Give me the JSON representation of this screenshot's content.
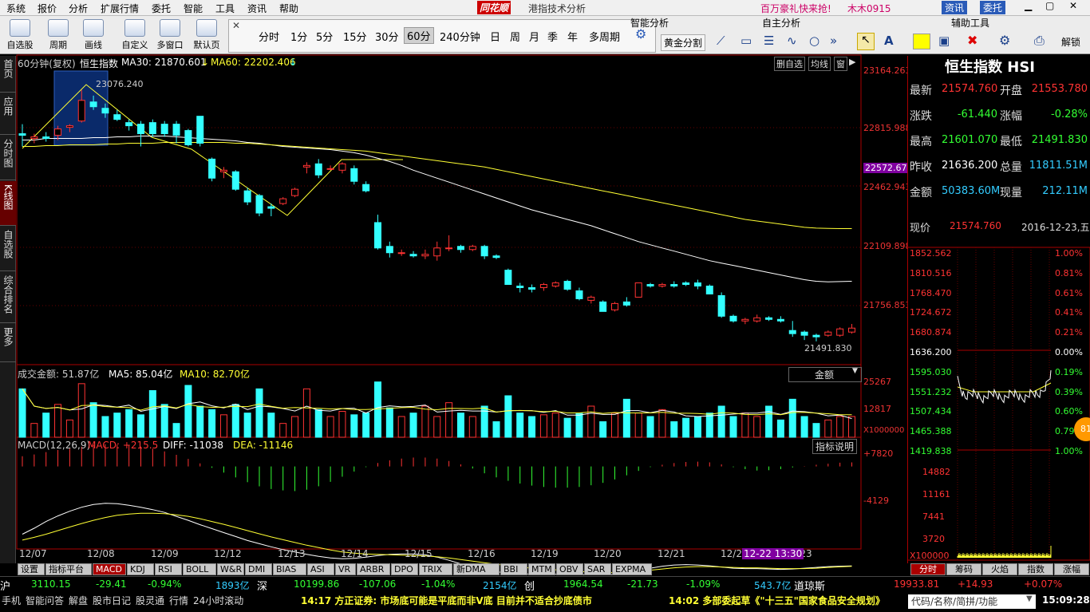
{
  "menubar": {
    "items": [
      "系统",
      "报价",
      "分析",
      "扩展行情",
      "委托",
      "智能",
      "工具",
      "资讯",
      "帮助"
    ],
    "brand": "同花顺",
    "window_title": "港指技术分析",
    "promo": "百万豪礼快来抢!",
    "user": "木木0915",
    "right_btns": [
      "资讯",
      "委托"
    ]
  },
  "toolbar": {
    "buttons": [
      "自选股",
      "周期",
      "画线",
      "自定义",
      "多窗口",
      "默认页"
    ],
    "periods": [
      "分时",
      "1分",
      "5分",
      "15分",
      "30分",
      "60分",
      "240分钟",
      "日",
      "周",
      "月",
      "季",
      "年",
      "多周期"
    ],
    "selected_period": "60分",
    "smart_title": "智能分析",
    "golden": "黄金分割",
    "self_title": "自主分析",
    "aux_title": "辅助工具",
    "aux_a": "A",
    "unlock": "解锁"
  },
  "leftnav": [
    "首页",
    "应用",
    "分时图",
    "K线图",
    "自选股",
    "综合排名",
    "更多"
  ],
  "chart_header": {
    "period": "60分钟(复权)",
    "name": "恒生指数",
    "ma30_label": "MA30: 21870.601",
    "ma60_label": "MA60: 22202.406",
    "arrows": [
      "↓",
      "↓"
    ],
    "right_tabs": [
      "删自选",
      "均线",
      "窗"
    ]
  },
  "kline": {
    "ylim": [
      21380,
      23200
    ],
    "y_labels": [
      "23164.263",
      "22815.988",
      "22572.67",
      "22462.943",
      "22109.898",
      "21756.853"
    ],
    "highlight_label": "22572.67",
    "high_label": "23076.240",
    "low_label": "21491.830",
    "dates": [
      "12/07",
      "12/08",
      "12/09",
      "12/12",
      "12/13",
      "12/14",
      "12/15",
      "12/16",
      "12/19",
      "12/20",
      "12/21",
      "12/22",
      "12/23"
    ],
    "cursor_label": "12-22 13:30"
  },
  "chart_data": [
    {
      "type": "candlestick",
      "title": "恒生指数",
      "candles": [
        [
          22800,
          22860,
          22720,
          22790
        ],
        [
          22770,
          22800,
          22740,
          22780
        ],
        [
          22780,
          22810,
          22750,
          22770
        ],
        [
          22790,
          22850,
          22760,
          22830
        ],
        [
          22840,
          22860,
          22810,
          22850
        ],
        [
          22880,
          23076,
          22870,
          23010
        ],
        [
          23000,
          23040,
          22950,
          22970
        ],
        [
          22960,
          22990,
          22900,
          22930
        ],
        [
          22920,
          22950,
          22880,
          22890
        ],
        [
          22870,
          22890,
          22820,
          22850
        ],
        [
          22860,
          22880,
          22720,
          22800
        ],
        [
          22870,
          22890,
          22780,
          22800
        ],
        [
          22860,
          22880,
          22780,
          22800
        ],
        [
          22860,
          22880,
          22740,
          22790
        ],
        [
          22820,
          22830,
          22720,
          22730
        ],
        [
          22910,
          22910,
          22720,
          22740
        ],
        [
          22640,
          22650,
          22500,
          22520
        ],
        [
          22560,
          22590,
          22520,
          22570
        ],
        [
          22560,
          22570,
          22440,
          22450
        ],
        [
          22440,
          22460,
          22350,
          22370
        ],
        [
          22410,
          22420,
          22280,
          22300
        ],
        [
          22340,
          22360,
          22280,
          22330
        ],
        [
          22360,
          22400,
          22350,
          22390
        ],
        [
          22410,
          22460,
          22400,
          22450
        ],
        [
          22590,
          22620,
          22550,
          22600
        ],
        [
          22610,
          22640,
          22520,
          22540
        ],
        [
          22580,
          22600,
          22570,
          22580
        ],
        [
          22570,
          22620,
          22550,
          22610
        ],
        [
          22580,
          22600,
          22480,
          22500
        ],
        [
          22480,
          22500,
          22430,
          22440
        ],
        [
          22240,
          22290,
          22070,
          22080
        ],
        [
          22090,
          22120,
          22020,
          22050
        ],
        [
          22050,
          22070,
          22030,
          22050
        ],
        [
          22040,
          22060,
          22020,
          22030
        ],
        [
          22030,
          22070,
          22010,
          22040
        ],
        [
          22030,
          22120,
          22000,
          22080
        ],
        [
          22080,
          22160,
          22060,
          22080
        ],
        [
          22090,
          22100,
          22050,
          22070
        ],
        [
          22070,
          22100,
          22060,
          22090
        ],
        [
          22090,
          22100,
          22010,
          22030
        ],
        [
          22030,
          22040,
          22010,
          22020
        ],
        [
          21940,
          21950,
          21850,
          21850
        ],
        [
          21840,
          21860,
          21800,
          21830
        ],
        [
          21830,
          21850,
          21800,
          21820
        ],
        [
          21830,
          21860,
          21810,
          21850
        ],
        [
          21840,
          21870,
          21830,
          21860
        ],
        [
          21870,
          21880,
          21810,
          21820
        ],
        [
          21810,
          21830,
          21750,
          21760
        ],
        [
          21750,
          21780,
          21730,
          21770
        ],
        [
          21740,
          21750,
          21680,
          21680
        ],
        [
          21690,
          21740,
          21680,
          21730
        ],
        [
          21740,
          21770,
          21710,
          21720
        ],
        [
          21770,
          21860,
          21770,
          21860
        ],
        [
          21850,
          21860,
          21830,
          21840
        ],
        [
          21840,
          21860,
          21830,
          21850
        ],
        [
          21850,
          21870,
          21830,
          21840
        ],
        [
          21860,
          21870,
          21840,
          21850
        ],
        [
          21860,
          21880,
          21820,
          21840
        ],
        [
          21840,
          21850,
          21790,
          21790
        ],
        [
          21780,
          21800,
          21640,
          21650
        ],
        [
          21650,
          21660,
          21610,
          21620
        ],
        [
          21620,
          21640,
          21600,
          21630
        ],
        [
          21620,
          21660,
          21610,
          21640
        ],
        [
          21640,
          21650,
          21620,
          21630
        ],
        [
          21630,
          21650,
          21610,
          21620
        ],
        [
          21560,
          21620,
          21520,
          21540
        ],
        [
          21550,
          21560,
          21500,
          21530
        ],
        [
          21530,
          21540,
          21491.83,
          21520
        ],
        [
          21530,
          21560,
          21520,
          21550
        ],
        [
          21530,
          21580,
          21520,
          21570
        ],
        [
          21550,
          21601.07,
          21540,
          21575
        ]
      ],
      "ma30": [
        22760,
        22760,
        22770,
        22770,
        22770,
        22770,
        22775,
        22775,
        22780,
        22780,
        22785,
        22785,
        22785,
        22780,
        22775,
        22770,
        22765,
        22760,
        22755,
        22745,
        22740,
        22730,
        22720,
        22715,
        22710,
        22705,
        22700,
        22690,
        22680,
        22665,
        22645,
        22625,
        22600,
        22570,
        22545,
        22520,
        22495,
        22470,
        22445,
        22420,
        22395,
        22370,
        22345,
        22320,
        22300,
        22280,
        22260,
        22240,
        22220,
        22195,
        22170,
        22145,
        22120,
        22100,
        22080,
        22060,
        22040,
        22020,
        22000,
        21985,
        21970,
        21955,
        21940,
        21925,
        21910,
        21895,
        21880,
        21870,
        21866,
        21868,
        21870
      ],
      "ma60": [
        22720,
        22720,
        22725,
        22725,
        22730,
        22730,
        22730,
        22735,
        22735,
        22740,
        22740,
        22740,
        22745,
        22745,
        22745,
        22745,
        22745,
        22745,
        22740,
        22740,
        22735,
        22730,
        22725,
        22720,
        22715,
        22710,
        22705,
        22700,
        22695,
        22690,
        22680,
        22670,
        22660,
        22650,
        22640,
        22630,
        22620,
        22610,
        22600,
        22590,
        22575,
        22560,
        22545,
        22530,
        22515,
        22500,
        22485,
        22470,
        22455,
        22440,
        22425,
        22410,
        22395,
        22380,
        22365,
        22350,
        22335,
        22320,
        22305,
        22290,
        22275,
        22260,
        22250,
        22240,
        22230,
        22220,
        22210,
        22205,
        22203,
        22202,
        22202
      ]
    },
    {
      "type": "bar",
      "title": "成交金额",
      "ylabel": "X1000000",
      "ylim": [
        0,
        36000
      ],
      "y_labels": [
        "25267",
        "12817"
      ],
      "values": [
        28000,
        8000,
        14000,
        19000,
        10000,
        31000,
        20000,
        12000,
        14000,
        16000,
        13000,
        27000,
        19000,
        8000,
        30000,
        18000,
        16000,
        13000,
        19000,
        14000,
        28000,
        14000,
        8000,
        12000,
        28000,
        16000,
        12000,
        15000,
        13000,
        14000,
        32000,
        17000,
        12000,
        14000,
        18000,
        12000,
        20000,
        14000,
        12000,
        18000,
        9000,
        24000,
        14000,
        12000,
        13000,
        14000,
        11000,
        14000,
        18000,
        9000,
        14000,
        22000,
        14000,
        12000,
        16000,
        9000,
        11000,
        12000,
        14000,
        18000,
        12000,
        14000,
        12000,
        18000,
        10000,
        22000,
        12000,
        8000,
        10000,
        12000,
        12000
      ],
      "series": [
        {
          "name": "MA5",
          "values": "85.04亿"
        },
        {
          "name": "MA10",
          "values": "82.70亿"
        }
      ]
    },
    {
      "type": "bar",
      "title": "MACD(12,26,9)",
      "ylim": [
        -14000,
        10000
      ],
      "y_labels": [
        "+7820",
        "-4129"
      ],
      "macd_hist": [
        3000,
        3500,
        4200,
        4800,
        5200,
        5800,
        6300,
        6500,
        6400,
        6200,
        5800,
        5200,
        4400,
        3400,
        2200,
        900,
        -400,
        -1800,
        -3200,
        -4600,
        -5800,
        -6600,
        -7000,
        -7200,
        -6800,
        -5800,
        -4500,
        -3000,
        -1500,
        -200,
        1000,
        1800,
        2300,
        2600,
        2600,
        2300,
        1600,
        600,
        -600,
        -2000,
        -3200,
        -4200,
        -5000,
        -5600,
        -6000,
        -6200,
        -6200,
        -6000,
        -5500,
        -4800,
        -3800,
        -2600,
        -1300,
        -200,
        500,
        1000,
        1300,
        1400,
        1200,
        600,
        -200,
        -800,
        -1200,
        -1100,
        -800,
        -300,
        100,
        500,
        800,
        1100,
        1200
      ],
      "diff": [
        -3000,
        -1500,
        200,
        1600,
        2800,
        3800,
        4500,
        4800,
        4700,
        4300,
        3800,
        3200,
        2500,
        1500,
        500,
        -600,
        -1600,
        -2600,
        -3600,
        -4600,
        -5400,
        -6200,
        -6900,
        -7500,
        -8100,
        -8600,
        -9000,
        -9200,
        -9100,
        -8800,
        -8400,
        -8100,
        -8000,
        -8000,
        -8200,
        -8800,
        -9600,
        -10500,
        -11300,
        -12000,
        -12500,
        -12800,
        -13000,
        -13100,
        -13100,
        -13100,
        -13100,
        -13200,
        -13300,
        -13300,
        -13200,
        -12800,
        -12200,
        -11600,
        -11100,
        -10800,
        -10700,
        -10800,
        -11000,
        -11300,
        -11600,
        -11700,
        -11700,
        -11800,
        -11900,
        -11800,
        -11600,
        -11400,
        -11200,
        -11100,
        -11038
      ],
      "dea": [
        -4500,
        -3800,
        -3000,
        -2100,
        -1200,
        -300,
        500,
        1200,
        1800,
        2100,
        2300,
        2300,
        2200,
        1900,
        1500,
        900,
        200,
        -500,
        -1300,
        -2100,
        -2900,
        -3700,
        -4400,
        -5100,
        -5800,
        -6400,
        -7000,
        -7500,
        -7800,
        -8000,
        -8100,
        -8200,
        -8300,
        -8400,
        -8500,
        -8700,
        -9000,
        -9400,
        -9800,
        -10200,
        -10600,
        -11000,
        -11300,
        -11600,
        -11800,
        -12000,
        -12200,
        -12400,
        -12600,
        -12700,
        -12700,
        -12600,
        -12400,
        -12100,
        -11800,
        -11500,
        -11300,
        -11200,
        -11200,
        -11300,
        -11400,
        -11500,
        -11500,
        -11600,
        -11700,
        -11700,
        -11700,
        -11600,
        -11400,
        -11250,
        -11146
      ]
    }
  ],
  "vol_header": {
    "label": "成交金额: 51.87亿",
    "ma5": "MA5: 85.04亿",
    "ma10": "MA10: 82.70亿",
    "dropdown": "金额"
  },
  "macd_header": {
    "label": "MACD(12,26,9)",
    "macd": "MACD: +215.5",
    "diff": "DIFF: -11038",
    "dea": "DEA: -11146",
    "explain": "指标说明"
  },
  "indicator_tabs": [
    "设置",
    "指标平台",
    "MACD",
    "KDJ",
    "RSI",
    "BOLL",
    "W&R",
    "DMI",
    "BIAS",
    "ASI",
    "VR",
    "ARBR",
    "DPO",
    "TRIX",
    "新DMA",
    "BBI",
    "MTM",
    "OBV",
    "SAR",
    "EXPMA"
  ],
  "selected_indicator": "MACD",
  "right_panel": {
    "title": "恒生指数 HSI",
    "rows": [
      {
        "l1": "最新",
        "v1": "21574.760",
        "c1": "#ff3333",
        "l2": "开盘",
        "v2": "21553.780",
        "c2": "#ff3333"
      },
      {
        "l1": "涨跌",
        "v1": "-61.440",
        "c1": "#33ff33",
        "l2": "涨幅",
        "v2": "-0.28%",
        "c2": "#33ff33"
      },
      {
        "l1": "最高",
        "v1": "21601.070",
        "c1": "#33ff33",
        "l2": "最低",
        "v2": "21491.830",
        "c2": "#33ff33"
      },
      {
        "l1": "昨收",
        "v1": "21636.200",
        "c1": "#ffffff",
        "l2": "总量",
        "v2": "11811.51M",
        "c2": "#33ccff"
      },
      {
        "l1": "金额",
        "v1": "50383.60M",
        "c1": "#33ccff",
        "l2": "现量",
        "v2": "212.11M",
        "c2": "#33ccff"
      }
    ],
    "now_label": "现价",
    "now_value": "21574.760",
    "date": "2016-12-23,五",
    "mini_left": [
      "1852.562",
      "1810.516",
      "1768.470",
      "1724.672",
      "1680.874",
      "1636.200",
      "1595.030",
      "1551.232",
      "1507.434",
      "1465.388",
      "1419.838"
    ],
    "mini_right": [
      "1.00%",
      "0.81%",
      "0.61%",
      "0.41%",
      "0.21%",
      "0.00%",
      "0.19%",
      "0.39%",
      "0.60%",
      "0.79%",
      "1.00%"
    ],
    "mini_vol": [
      "14882",
      "11161",
      "7441",
      "3720"
    ],
    "mini_unit": "X100000",
    "tabs": [
      "分时",
      "筹码",
      "火焰",
      "指数",
      "涨幅"
    ],
    "badge": "81"
  },
  "ticker": {
    "items": [
      {
        "name": "沪",
        "price": "3110.15",
        "chg": "-29.41",
        "pct": "-0.94%",
        "amt": "1893亿"
      },
      {
        "name": "深",
        "price": "10199.86",
        "chg": "-107.06",
        "pct": "-1.04%",
        "amt": "2154亿"
      },
      {
        "name": "创",
        "price": "1964.54",
        "chg": "-21.73",
        "pct": "-1.09%",
        "amt": "543.7亿"
      },
      {
        "name": "道琼斯",
        "price": "19933.81",
        "chg": "+14.93",
        "pct": "+0.07%",
        "amt": ""
      }
    ]
  },
  "statusbar": {
    "left": [
      "手机",
      "智能问答",
      "解盘",
      "股市日记",
      "股灵通",
      "行情",
      "24小时滚动"
    ],
    "news1": "14:17 方正证券: 市场底可能是平底而非V底 目前并不适合抄底债市",
    "news2": "14:02 多部委起草《\"十三五\"国家食品安全规划》",
    "search": "代码/名称/简拼/功能",
    "time": "15:09:28"
  },
  "colors": {
    "up": "#ff3333",
    "down": "#33ffff",
    "ma30": "#ffffff",
    "ma60": "#ffff33",
    "frame": "#aa0000"
  }
}
